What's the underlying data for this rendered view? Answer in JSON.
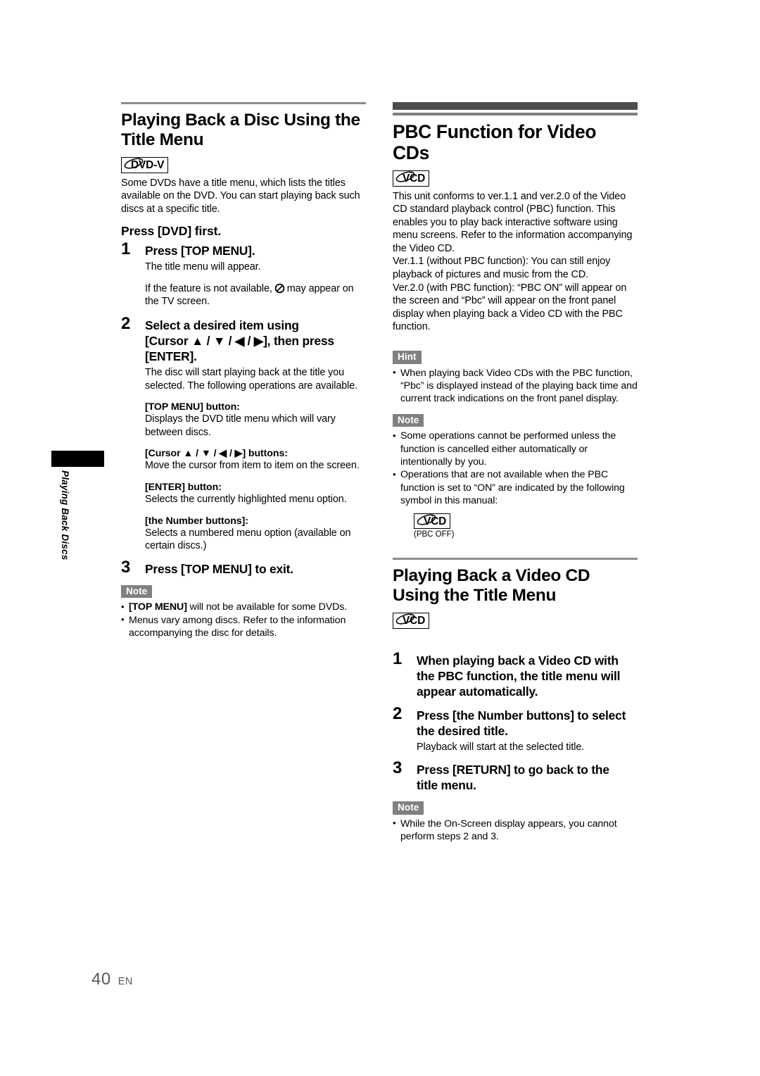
{
  "side_tab": {
    "label": "Playing Back Discs"
  },
  "footer": {
    "page_number": "40",
    "language": "EN"
  },
  "left_column": {
    "section_title": "Playing Back a Disc Using the Title Menu",
    "badge": {
      "text": "DVD-V",
      "icon": "disc-swoosh-icon"
    },
    "intro": "Some DVDs have a title menu, which lists the titles available on the DVD. You can start playing back such discs at a specific title.",
    "lead_instruction": "Press [DVD] first.",
    "steps": [
      {
        "number": "1",
        "heading": "Press [TOP MENU].",
        "body": "The title menu will appear.",
        "body2_before": "If the feature is not available,",
        "body2_symbol": "prohibition-icon",
        "body2_after": "may appear on the TV screen."
      },
      {
        "number": "2",
        "heading_parts": [
          "Select a desired item using",
          "[Cursor ▲ / ▼ / ◀ / ▶], then press",
          "[ENTER]."
        ],
        "body": "The disc will start playing back at the title you selected. The following operations are available.",
        "sub_items": [
          {
            "title": "[TOP MENU] button:",
            "text": "Displays the DVD title menu which will vary between discs."
          },
          {
            "title": "[Cursor ▲ / ▼ / ◀ / ▶] buttons:",
            "text": "Move the cursor from item to item on the screen."
          },
          {
            "title": "[ENTER] button:",
            "text": "Selects the currently highlighted menu option."
          },
          {
            "title": "[the Number buttons]:",
            "text": "Selects a numbered menu option (available on certain discs.)"
          }
        ]
      },
      {
        "number": "3",
        "heading": "Press [TOP MENU] to exit."
      }
    ],
    "note": {
      "label": "Note",
      "items": [
        {
          "bold": "[TOP MENU]",
          "rest": " will not be available for some DVDs."
        },
        {
          "bold": "",
          "rest": "Menus vary among discs. Refer to the information accompanying the disc for details."
        }
      ]
    }
  },
  "right_column": {
    "section_title": "PBC Function for Video CDs",
    "badge": {
      "text": "VCD",
      "icon": "disc-swoosh-icon"
    },
    "paragraphs": [
      "This unit conforms to ver.1.1 and ver.2.0 of the Video CD standard playback control (PBC) function. This enables you to play back interactive software using menu screens. Refer to the information accompanying the Video CD.",
      "Ver.1.1 (without PBC function): You can still enjoy playback of pictures and music from the CD.",
      "Ver.2.0 (with PBC function): “PBC ON” will appear on the screen and “Pbc” will appear on the front panel display when playing back a Video CD with the PBC function."
    ],
    "hint": {
      "label": "Hint",
      "items": [
        "When playing back Video CDs with the PBC function, “Pbc” is displayed instead of the playing back time and current track indications on the front panel display."
      ]
    },
    "note": {
      "label": "Note",
      "items": [
        "Some operations cannot be performed unless the function is cancelled either automatically or intentionally by you.",
        "Operations that are not available when the PBC function is set to “ON” are indicated by the following symbol in this manual:"
      ],
      "symbol_badge": {
        "text": "VCD",
        "caption": "(PBC OFF)",
        "icon": "disc-swoosh-icon"
      }
    },
    "section2_title": "Playing Back a Video CD Using the Title Menu",
    "section2_badge": {
      "text": "VCD",
      "icon": "disc-swoosh-icon"
    },
    "section2_steps": [
      {
        "number": "1",
        "heading_parts": [
          "When playing back a Video CD with",
          "the PBC function, the title menu will",
          "appear automatically."
        ]
      },
      {
        "number": "2",
        "heading_parts": [
          "Press [the Number buttons] to select",
          "the desired title."
        ],
        "body": "Playback will start at the selected title."
      },
      {
        "number": "3",
        "heading_parts": [
          "Press [RETURN] to go back to the",
          "title menu."
        ]
      }
    ],
    "section2_note": {
      "label": "Note",
      "items": [
        "While the On-Screen display appears, you cannot perform steps 2 and 3."
      ]
    }
  }
}
